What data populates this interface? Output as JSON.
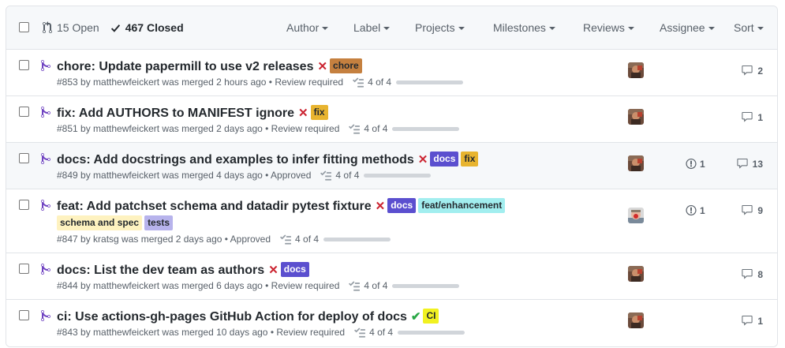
{
  "header": {
    "open_label": "15 Open",
    "closed_label": "467 Closed",
    "filters": [
      "Author",
      "Label",
      "Projects",
      "Milestones",
      "Reviews",
      "Assignee",
      "Sort"
    ]
  },
  "colors": {
    "merged_icon": "#6f42c1",
    "status_fail": "#cb2431",
    "status_success": "#28a745"
  },
  "pulls": [
    {
      "title": "chore: Update papermill to use v2 releases",
      "status": "fail",
      "labels": [
        {
          "name": "chore",
          "bg": "#c5803f",
          "fg": "#24292e"
        }
      ],
      "meta": "#853 by matthewfeickert was merged 2 hours ago • Review required",
      "tasks": "4 of 4",
      "tasks_progress": 1.0,
      "avatar": "matthewfeickert",
      "linked_issues": null,
      "comments": "2"
    },
    {
      "title": "fix: Add AUTHORS to MANIFEST ignore",
      "status": "fail",
      "labels": [
        {
          "name": "fix",
          "bg": "#e8b42f",
          "fg": "#24292e"
        }
      ],
      "meta": "#851 by matthewfeickert was merged 2 days ago • Review required",
      "tasks": "4 of 4",
      "tasks_progress": 1.0,
      "avatar": "matthewfeickert",
      "linked_issues": null,
      "comments": "1"
    },
    {
      "title": "docs: Add docstrings and examples to infer fitting methods",
      "status": "fail",
      "labels": [
        {
          "name": "docs",
          "bg": "#5b4fcf",
          "fg": "#ffffff"
        },
        {
          "name": "fix",
          "bg": "#e8b42f",
          "fg": "#24292e"
        }
      ],
      "meta": "#849 by matthewfeickert was merged 4 days ago • Approved",
      "tasks": "4 of 4",
      "tasks_progress": 1.0,
      "avatar": "matthewfeickert",
      "linked_issues": "1",
      "comments": "13"
    },
    {
      "title": "feat: Add patchset schema and datadir pytest fixture",
      "status": "fail",
      "labels": [
        {
          "name": "docs",
          "bg": "#5b4fcf",
          "fg": "#ffffff"
        },
        {
          "name": "feat/enhancement",
          "bg": "#a2eeef",
          "fg": "#24292e"
        },
        {
          "name": "schema and spec",
          "bg": "#fef2c0",
          "fg": "#24292e"
        },
        {
          "name": "tests",
          "bg": "#b7b3ec",
          "fg": "#24292e"
        }
      ],
      "meta": "#847 by kratsg was merged 2 days ago • Approved",
      "tasks": "4 of 4",
      "tasks_progress": 1.0,
      "avatar": "kratsg",
      "linked_issues": "1",
      "comments": "9"
    },
    {
      "title": "docs: List the dev team as authors",
      "status": "fail",
      "labels": [
        {
          "name": "docs",
          "bg": "#5b4fcf",
          "fg": "#ffffff"
        }
      ],
      "meta": "#844 by matthewfeickert was merged 6 days ago • Review required",
      "tasks": "4 of 4",
      "tasks_progress": 1.0,
      "avatar": "matthewfeickert",
      "linked_issues": null,
      "comments": "8"
    },
    {
      "title": "ci: Use actions-gh-pages GitHub Action for deploy of docs",
      "status": "success",
      "labels": [
        {
          "name": "CI",
          "bg": "#f1f120",
          "fg": "#24292e"
        }
      ],
      "meta": "#843 by matthewfeickert was merged 10 days ago • Review required",
      "tasks": "4 of 4",
      "tasks_progress": 1.0,
      "avatar": "matthewfeickert",
      "linked_issues": null,
      "comments": "1"
    }
  ]
}
